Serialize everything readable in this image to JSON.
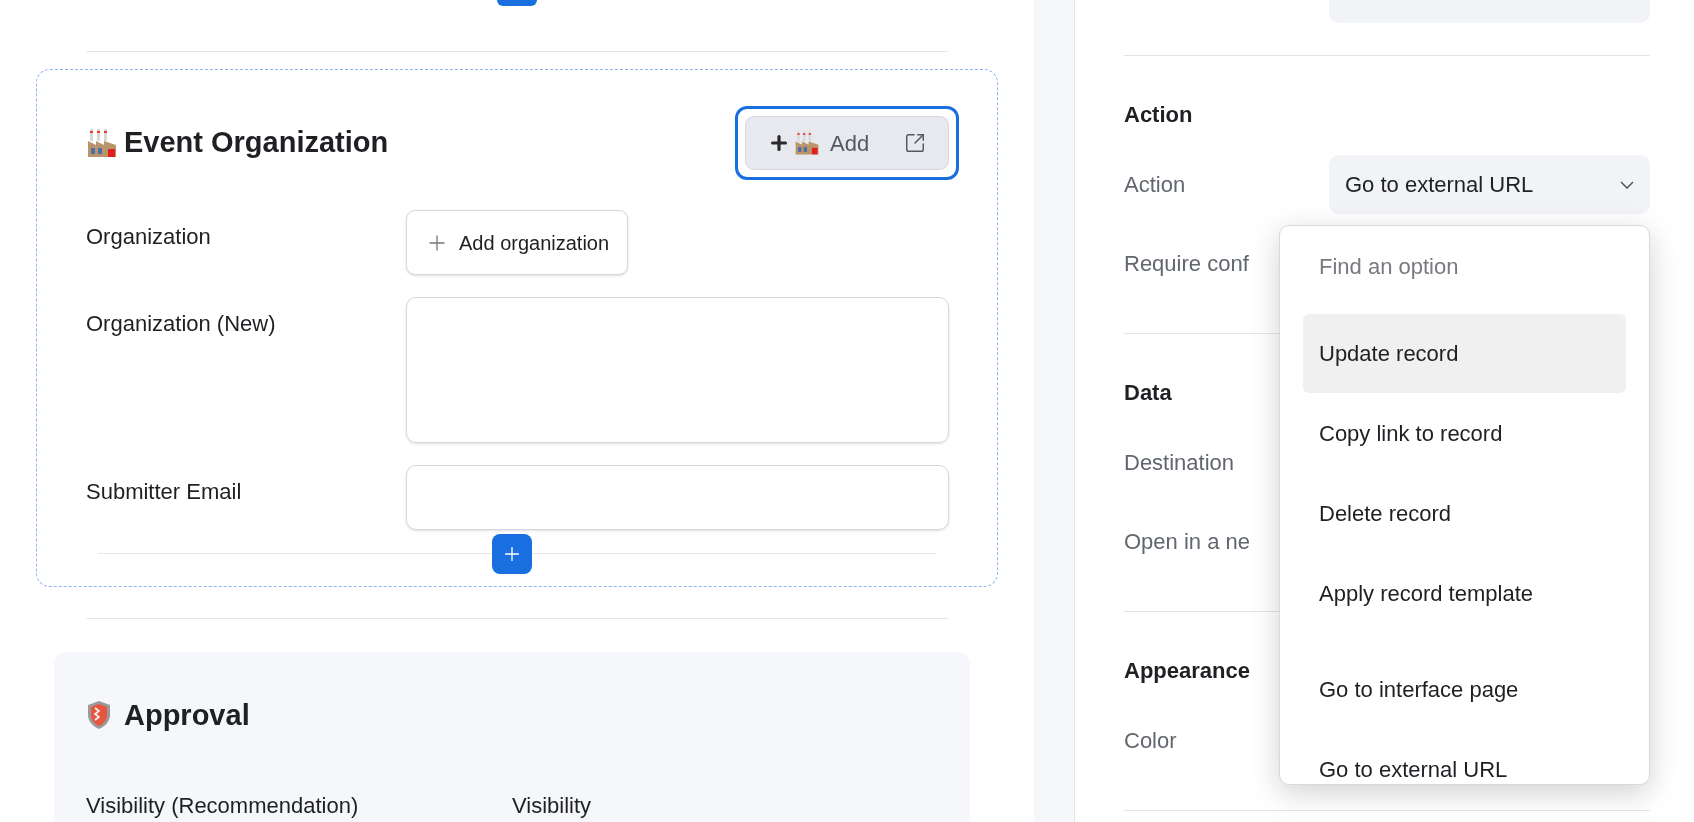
{
  "canvas": {
    "section": {
      "title": "Event Organization",
      "selected": true,
      "button": {
        "label": "Add",
        "selected": true
      },
      "fields": [
        {
          "kind": "link",
          "label": "Organization",
          "button": "Add organization"
        },
        {
          "kind": "textarea",
          "label": "Organization (New)"
        },
        {
          "kind": "input",
          "label": "Submitter Email"
        }
      ]
    },
    "next_section": {
      "title": "Approval",
      "columns": [
        "Visibility (Recommendation)",
        "Visibility"
      ]
    }
  },
  "panel": {
    "groups": [
      {
        "title": "Action",
        "rows": [
          {
            "kind": "select",
            "label": "Action",
            "value": "Go to external URL",
            "expanded": true
          },
          {
            "kind": "plain",
            "label": "Require conf"
          }
        ]
      },
      {
        "title": "Data",
        "rows": [
          {
            "kind": "plain",
            "label": "Destination"
          },
          {
            "kind": "plain",
            "label": "Open in a ne"
          }
        ]
      },
      {
        "title": "Appearance",
        "rows": [
          {
            "kind": "plain",
            "label": "Color"
          }
        ]
      }
    ]
  },
  "dropdown": {
    "placeholder": "Find an option",
    "options": [
      {
        "label": "Update record",
        "selected": true
      },
      {
        "label": "Copy link to record",
        "selected": false
      },
      {
        "label": "Delete record",
        "selected": false
      },
      {
        "label": "Apply record template",
        "selected": false
      },
      {
        "label": "Go to interface page",
        "selected": false
      },
      {
        "label": "Go to external URL",
        "selected": false
      }
    ]
  }
}
